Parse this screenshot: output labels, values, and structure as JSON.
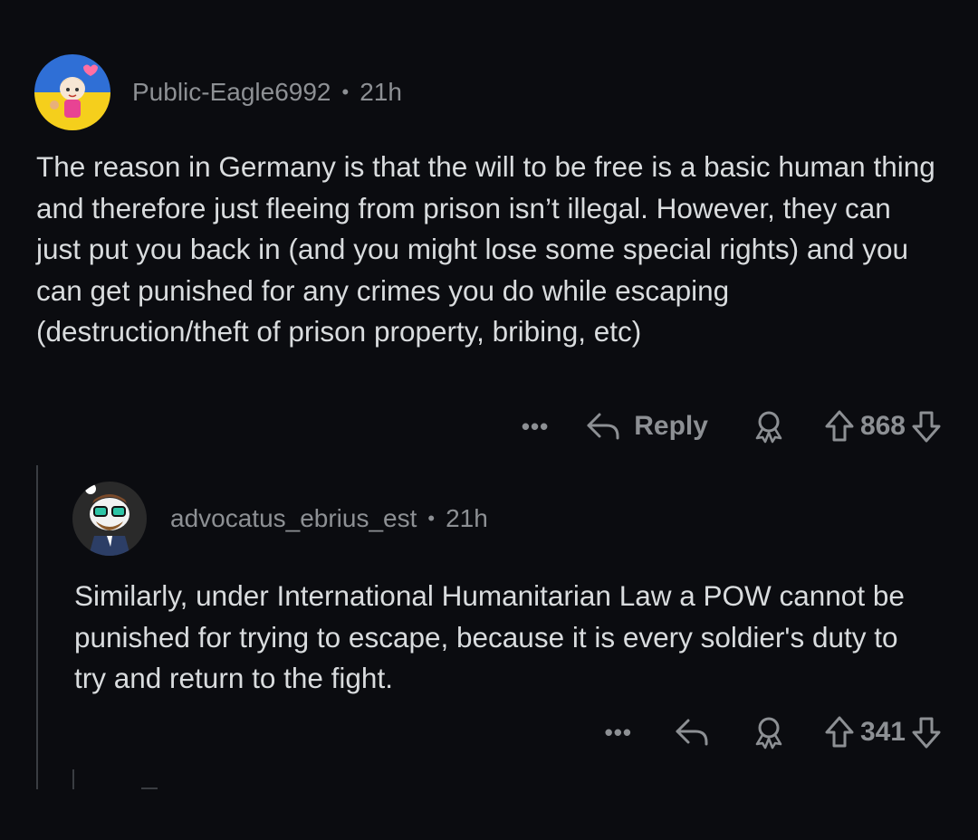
{
  "comments": [
    {
      "author": "Public-Eagle6992",
      "separator": "•",
      "time": "21h",
      "body": "The reason in Germany is that the will to be free is a basic human thing and therefore just fleeing from prison isn’t illegal. However, they can just put you back in (and you might lose some special rights) and you can get punished for any crimes you do while escaping (destruction/theft of prison property, bribing, etc)",
      "actions": {
        "more": "•••",
        "reply_label": "Reply",
        "score": "868"
      },
      "avatar_colors": {
        "top": "#2f6fd6",
        "bottom": "#f5cf1c"
      }
    },
    {
      "author": "advocatus_ebrius_est",
      "separator": "•",
      "time": "21h",
      "body": "Similarly, under International Humanitarian Law a POW cannot be punished for trying to escape, because it is every soldier's duty to try and return to the fight.",
      "actions": {
        "more": "•••",
        "score": "341"
      }
    }
  ],
  "icons": {
    "reply": "reply-arrow-icon",
    "award": "award-icon",
    "upvote": "upvote-arrow-icon",
    "downvote": "downvote-arrow-icon"
  },
  "colors": {
    "background": "#0b0c10",
    "text": "#d9dcde",
    "muted": "#8d9094"
  }
}
